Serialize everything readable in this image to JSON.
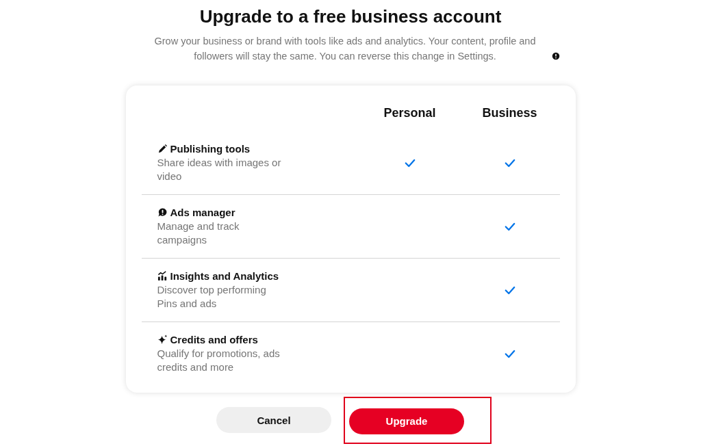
{
  "title": "Upgrade to a free business account",
  "subtitle": "Grow your business or brand with tools like ads and analytics. Your content, profile and followers will stay the same. You can reverse this change in Settings.",
  "columns": [
    "Personal",
    "Business"
  ],
  "features": [
    {
      "kind": "pencil",
      "title": "Publishing tools",
      "description": "Share ideas with images or video",
      "personal": true,
      "business": true
    },
    {
      "kind": "ads",
      "title": "Ads manager",
      "description": "Manage and track campaigns",
      "personal": false,
      "business": true
    },
    {
      "kind": "chart",
      "title": "Insights and Analytics",
      "description": "Discover top performing Pins and ads",
      "personal": false,
      "business": true
    },
    {
      "kind": "sparkle",
      "title": "Credits and offers",
      "description": "Qualify for promotions, ads credits and more",
      "personal": false,
      "business": true
    }
  ],
  "buttons": [
    {
      "kind": "secondary",
      "label": "Cancel",
      "highlighted": false
    },
    {
      "kind": "primary",
      "label": "Upgrade",
      "highlighted": true
    }
  ]
}
